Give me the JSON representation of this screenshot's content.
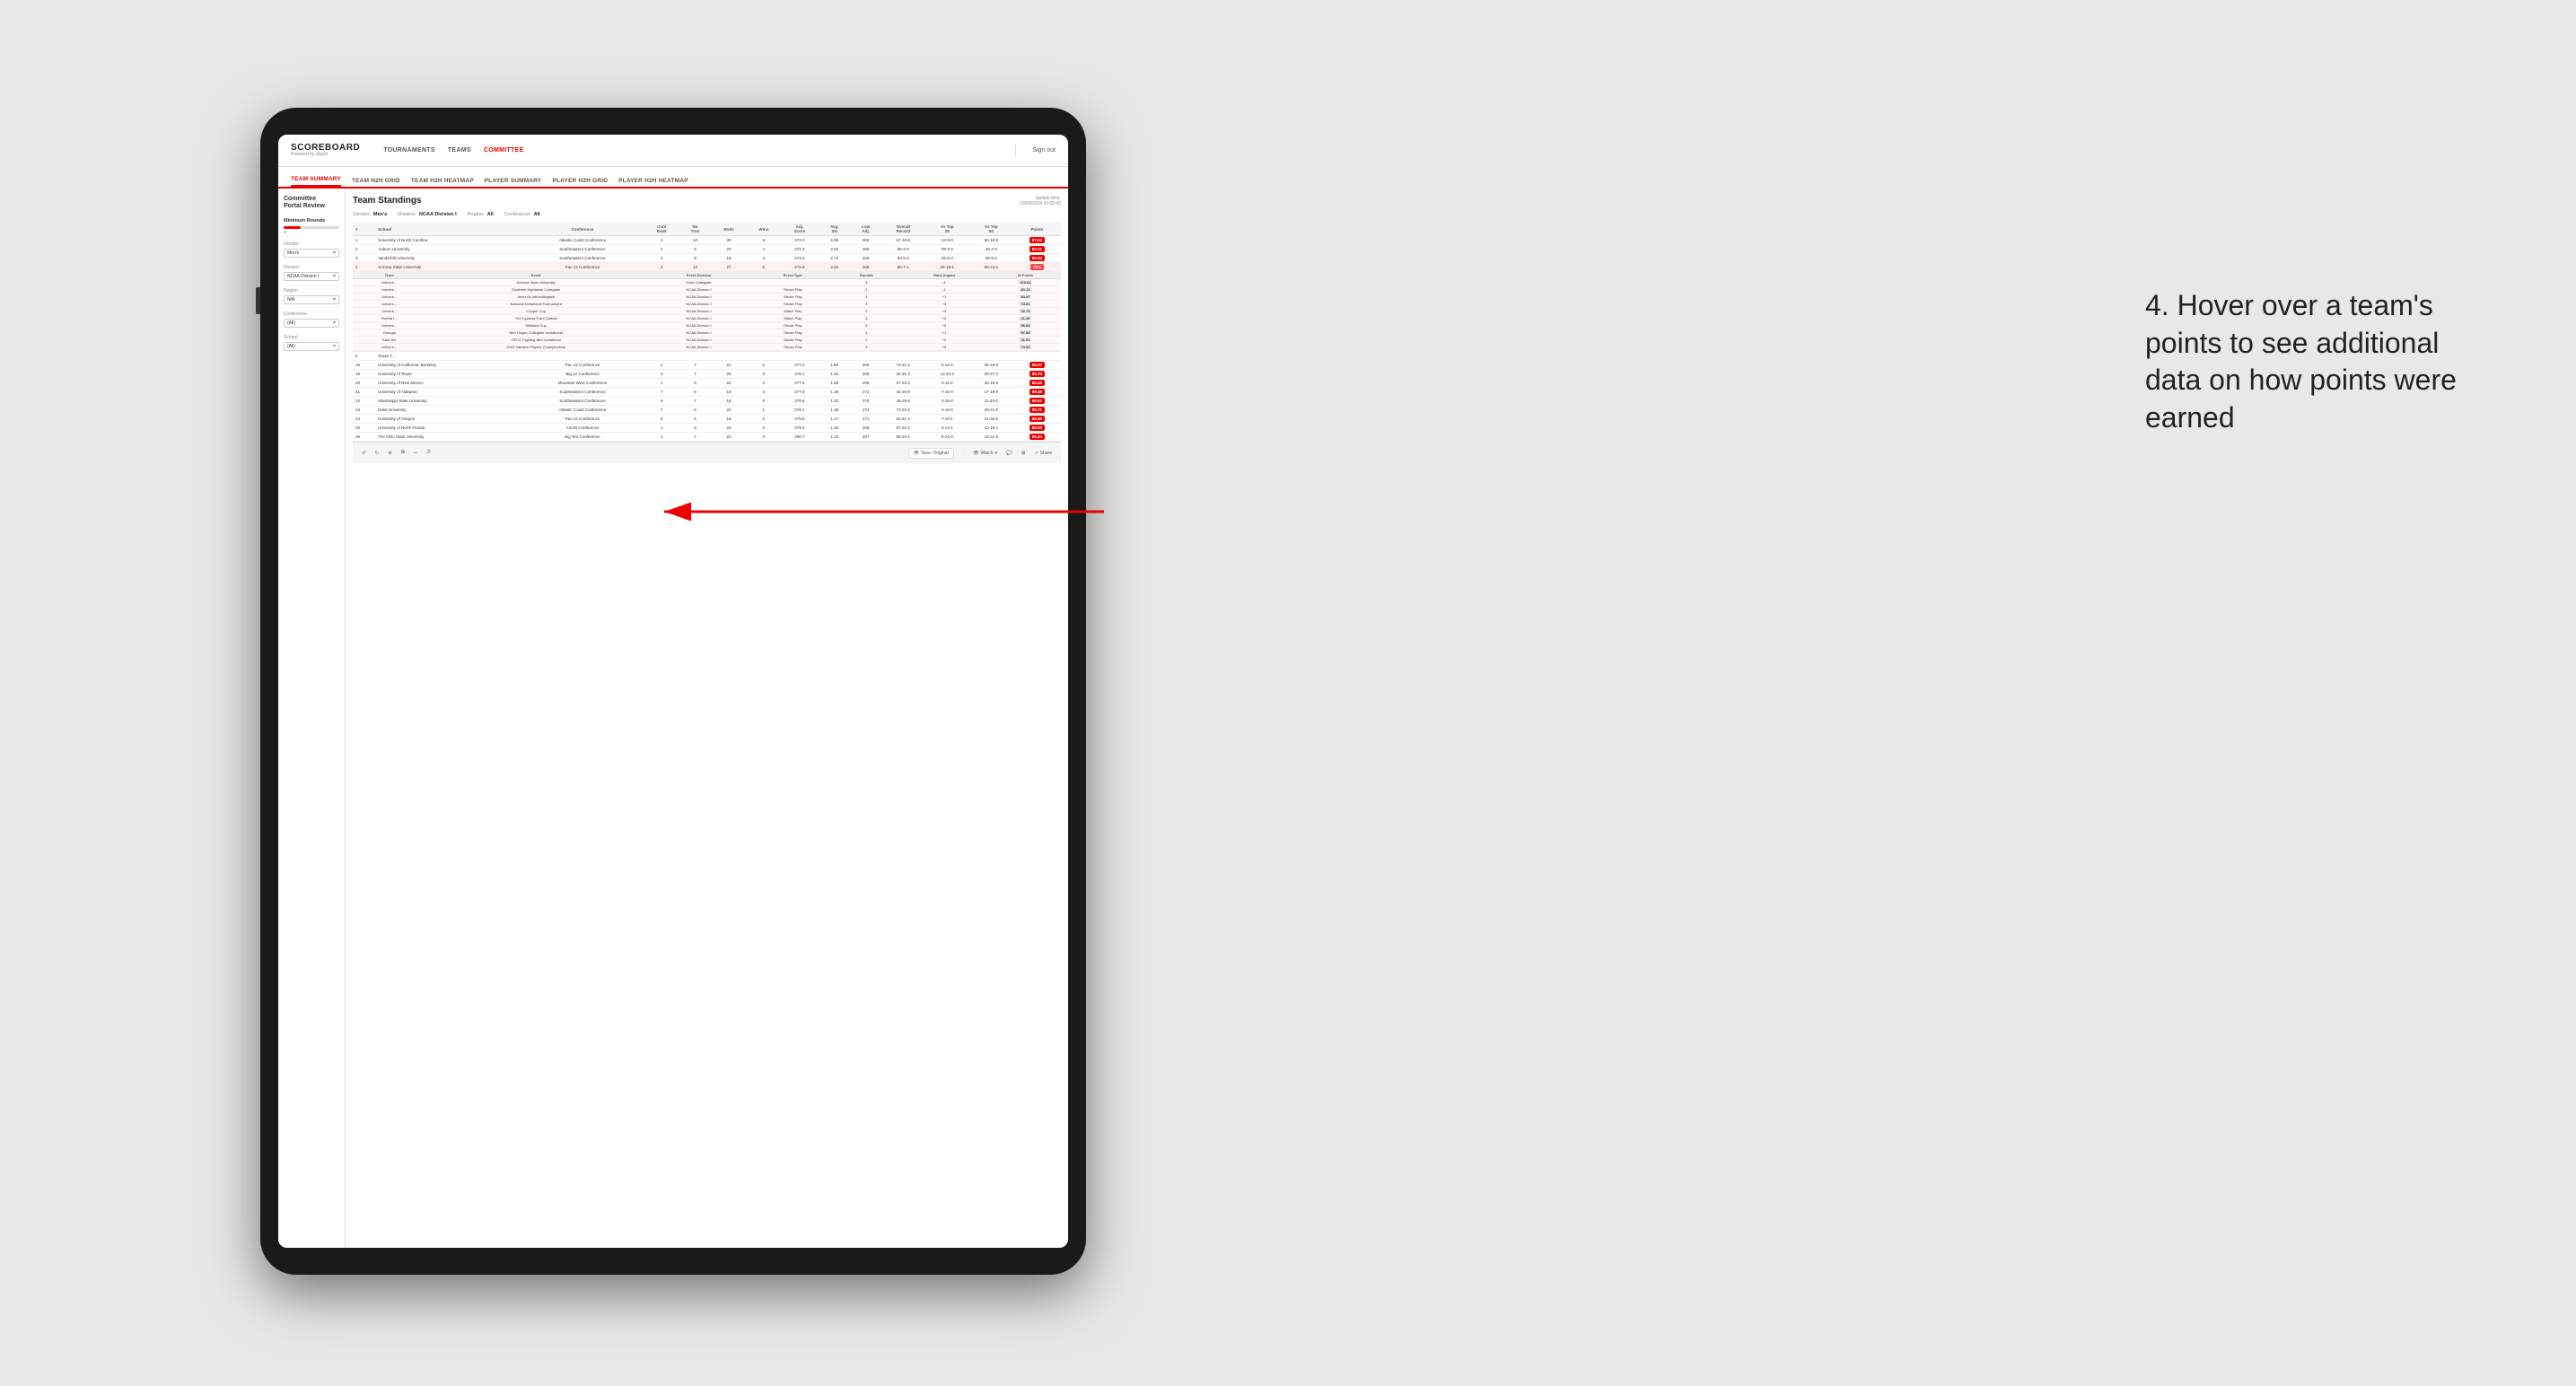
{
  "app": {
    "logo": "SCOREBOARD",
    "logo_sub": "Powered by clippd",
    "sign_out": "Sign out"
  },
  "nav": {
    "items": [
      {
        "label": "TOURNAMENTS",
        "active": false
      },
      {
        "label": "TEAMS",
        "active": false
      },
      {
        "label": "COMMITTEE",
        "active": true
      }
    ]
  },
  "subnav": {
    "items": [
      {
        "label": "TEAM SUMMARY",
        "active": true
      },
      {
        "label": "TEAM H2H GRID",
        "active": false
      },
      {
        "label": "TEAM H2H HEATMAP",
        "active": false
      },
      {
        "label": "PLAYER SUMMARY",
        "active": false
      },
      {
        "label": "PLAYER H2H GRID",
        "active": false
      },
      {
        "label": "PLAYER H2H HEATMAP",
        "active": false
      }
    ]
  },
  "sidebar": {
    "portal_title": "Committee\nPortal Review",
    "minimum_rounds_label": "Minimum Rounds",
    "minimum_rounds_value": "3",
    "gender_label": "Gender",
    "gender_value": "Men's",
    "division_label": "Division",
    "division_value": "NCAA Division I",
    "region_label": "Region",
    "region_value": "N/A",
    "conference_label": "Conference",
    "conference_value": "(All)",
    "school_label": "School",
    "school_value": "(All)"
  },
  "standings": {
    "title": "Team Standings",
    "update_time": "Update time:\n13/03/2024 10:03:42",
    "filters": {
      "gender_label": "Gender:",
      "gender_value": "Men's",
      "division_label": "Division:",
      "division_value": "NCAA Division I",
      "region_label": "Region:",
      "region_value": "All",
      "conference_label": "Conference:",
      "conference_value": "All"
    },
    "columns": [
      "#",
      "School",
      "Conference",
      "Conf Rank",
      "No Tour",
      "Rnds",
      "Wins",
      "Adj. Score",
      "Avg. SG",
      "Low Adj.",
      "Overall Record",
      "Vs Top 25",
      "Vs Top 50",
      "Points"
    ],
    "rows": [
      {
        "rank": 1,
        "school": "University of North Carolina",
        "conference": "Atlantic Coast Conference",
        "conf_rank": 1,
        "no_tour": 10,
        "rnds": 30,
        "wins": 9,
        "adj_score": 272.0,
        "avg_sg": 2.86,
        "low_adj": 262,
        "overall": "67-10-0",
        "vs25": "13-9-0",
        "vs50": "50-10-0",
        "points": "97.02",
        "highlighted": false
      },
      {
        "rank": 2,
        "school": "Auburn University",
        "conference": "Southeastern Conference",
        "conf_rank": 1,
        "no_tour": 9,
        "rnds": 23,
        "wins": 4,
        "adj_score": 272.3,
        "avg_sg": 2.82,
        "low_adj": 260,
        "overall": "86-4-0",
        "vs25": "29-4-0",
        "vs50": "35-4-0",
        "points": "93.31",
        "highlighted": false
      },
      {
        "rank": 3,
        "school": "Vanderbilt University",
        "conference": "Southeastern Conference",
        "conf_rank": 2,
        "no_tour": 8,
        "rnds": 19,
        "wins": 4,
        "adj_score": 272.6,
        "avg_sg": 2.73,
        "low_adj": 269,
        "overall": "63-5-0",
        "vs25": "25-5-0",
        "vs50": "65-5-0",
        "points": "90.32",
        "highlighted": false
      },
      {
        "rank": 4,
        "school": "Arizona State University",
        "conference": "Pac-12 Conference",
        "conf_rank": 2,
        "no_tour": 10,
        "rnds": 27,
        "wins": 5,
        "adj_score": 275.5,
        "avg_sg": 2.5,
        "low_adj": 265,
        "overall": "85-7-1",
        "vs25": "33-19-1",
        "vs50": "58-24-1",
        "points": "79.5",
        "highlighted": true
      },
      {
        "rank": 5,
        "school": "Texas T...",
        "conference": "",
        "conf_rank": "",
        "no_tour": "",
        "rnds": "",
        "wins": "",
        "adj_score": "",
        "avg_sg": "",
        "low_adj": "",
        "overall": "",
        "vs25": "",
        "vs50": "",
        "points": "",
        "highlighted": false
      }
    ],
    "expanded_section": {
      "visible": true,
      "team_col": "Team",
      "event_col": "Event",
      "event_div_col": "Event Division",
      "event_type_col": "Event Type",
      "rounds_col": "Rounds",
      "rank_impact_col": "Rank Impact",
      "w_points_col": "W Points",
      "rows": [
        {
          "team": "Univers...",
          "event": "Arizona State\nUniversity",
          "event_name": "",
          "event_division": "Celei Collegiate",
          "event_type": "",
          "rounds": 3,
          "rank_impact": -1,
          "points": "119.63"
        },
        {
          "team": "Univers...",
          "event": "",
          "event_name": "Southern Highlands Collegiate",
          "event_division": "NCAA Division I",
          "event_type": "Stroke Play",
          "rounds": 3,
          "rank_impact": -1,
          "points": "30-13"
        },
        {
          "team": "Univers...",
          "event": "",
          "event_name": "Amer Air Intercollegiate",
          "event_division": "NCAA Division I",
          "event_type": "Stroke Play",
          "rounds": 3,
          "rank_impact": "+1",
          "points": "84.97"
        },
        {
          "team": "Univers...",
          "event": "",
          "event_name": "National Invitational Tournament",
          "event_division": "NCAA Division I",
          "event_type": "Stroke Play",
          "rounds": 3,
          "rank_impact": "+5",
          "points": "74.01"
        },
        {
          "team": "Univers...",
          "event": "",
          "event_name": "Copper Cup",
          "event_division": "NCAA Division I",
          "event_type": "Match Play",
          "rounds": 2,
          "rank_impact": "+5",
          "points": "42.73"
        },
        {
          "team": "Florida I...",
          "event": "",
          "event_name": "The Cypress Point Classic",
          "event_division": "NCAA Division I",
          "event_type": "Match Play",
          "rounds": 3,
          "rank_impact": "+0",
          "points": "21.26"
        },
        {
          "team": "Univers...",
          "event": "",
          "event_name": "Williams Cup",
          "event_division": "NCAA Division I",
          "event_type": "Stroke Play",
          "rounds": 3,
          "rank_impact": "+0",
          "points": "56.66"
        },
        {
          "team": "Georgia",
          "event": "",
          "event_name": "Ben Hogan Collegiate Invitational",
          "event_division": "NCAA Division I",
          "event_type": "Stroke Play",
          "rounds": 3,
          "rank_impact": "+1",
          "points": "97.88"
        },
        {
          "team": "East Tee",
          "event": "",
          "event_name": "OFCC Fighting Illini Invitational",
          "event_division": "NCAA Division I",
          "event_type": "Stroke Play",
          "rounds": 2,
          "rank_impact": "+0",
          "points": "41.91"
        },
        {
          "team": "Univers...",
          "event": "",
          "event_name": "2023 Sahalee Players Championship",
          "event_division": "NCAA Division I",
          "event_type": "Stroke Play",
          "rounds": 3,
          "rank_impact": "+0",
          "points": "74.32"
        }
      ]
    },
    "additional_rows": [
      {
        "rank": 18,
        "school": "University of California, Berkeley",
        "conference": "Pac-12 Conference",
        "conf_rank": 4,
        "no_tour": 7,
        "rnds": 21,
        "wins": 2,
        "adj_score": 277.2,
        "avg_sg": 1.6,
        "low_adj": 260,
        "overall": "73-21-1",
        "vs25": "6-12-0",
        "vs50": "25-19-0",
        "points": "88.07"
      },
      {
        "rank": 19,
        "school": "University of Texas",
        "conference": "Big 12 Conference",
        "conf_rank": 3,
        "no_tour": 7,
        "rnds": 25,
        "wins": 0,
        "adj_score": 278.1,
        "avg_sg": 1.45,
        "low_adj": 266,
        "overall": "42-31-3",
        "vs25": "13-23-2",
        "vs50": "29-27-2",
        "points": "88.70"
      },
      {
        "rank": 20,
        "school": "University of New Mexico",
        "conference": "Mountain West Conference",
        "conf_rank": 1,
        "no_tour": 8,
        "rnds": 22,
        "wins": 0,
        "adj_score": 277.6,
        "avg_sg": 1.5,
        "low_adj": 265,
        "overall": "57-23-2",
        "vs25": "5-11-2",
        "vs50": "32-19-2",
        "points": "88.49"
      },
      {
        "rank": 21,
        "school": "University of Alabama",
        "conference": "Southeastern Conference",
        "conf_rank": 7,
        "no_tour": 6,
        "rnds": 15,
        "wins": 2,
        "adj_score": 277.9,
        "avg_sg": 1.45,
        "low_adj": 272,
        "overall": "42-20-0",
        "vs25": "7-15-0",
        "vs50": "17-19-0",
        "points": "88.48"
      },
      {
        "rank": 22,
        "school": "Mississippi State University",
        "conference": "Southeastern Conference",
        "conf_rank": 8,
        "no_tour": 7,
        "rnds": 18,
        "wins": 0,
        "adj_score": 278.6,
        "avg_sg": 1.32,
        "low_adj": 270,
        "overall": "46-29-0",
        "vs25": "4-16-0",
        "vs50": "11-23-0",
        "points": "88.61"
      },
      {
        "rank": 23,
        "school": "Duke University",
        "conference": "Atlantic Coast Conference",
        "conf_rank": 7,
        "no_tour": 8,
        "rnds": 22,
        "wins": 1,
        "adj_score": 278.1,
        "avg_sg": 1.38,
        "low_adj": 274,
        "overall": "71-22-2",
        "vs25": "4-15-0",
        "vs50": "29-21-0",
        "points": "88.71"
      },
      {
        "rank": 24,
        "school": "University of Oregon",
        "conference": "Pac-12 Conference",
        "conf_rank": 5,
        "no_tour": 6,
        "rnds": 18,
        "wins": 0,
        "adj_score": 278.6,
        "avg_sg": 1.17,
        "low_adj": 271,
        "overall": "53-41-1",
        "vs25": "7-19-1",
        "vs50": "21-32-0",
        "points": "88.58"
      },
      {
        "rank": 25,
        "school": "University of North Florida",
        "conference": "ASUN Conference",
        "conf_rank": 1,
        "no_tour": 8,
        "rnds": 24,
        "wins": 0,
        "adj_score": 279.3,
        "avg_sg": 1.3,
        "low_adj": 269,
        "overall": "87-22-2",
        "vs25": "3-14-1",
        "vs50": "12-18-1",
        "points": "88.59"
      },
      {
        "rank": 26,
        "school": "The Ohio State University",
        "conference": "Big Ten Conference",
        "conf_rank": 2,
        "no_tour": 7,
        "rnds": 22,
        "wins": 0,
        "adj_score": 280.7,
        "avg_sg": 1.22,
        "low_adj": 267,
        "overall": "55-23-1",
        "vs25": "9-14-0",
        "vs50": "19-21-0",
        "points": "88.34"
      }
    ]
  },
  "toolbar": {
    "undo": "↺",
    "redo": "↻",
    "zoom": "⊕",
    "copy": "⧉",
    "paint": "✏",
    "timer": "⏱",
    "view_label": "View: Original",
    "watch_label": "Watch",
    "share_label": "Share"
  },
  "annotation": {
    "text": "4. Hover over a team's points to see additional data on how points were earned"
  }
}
